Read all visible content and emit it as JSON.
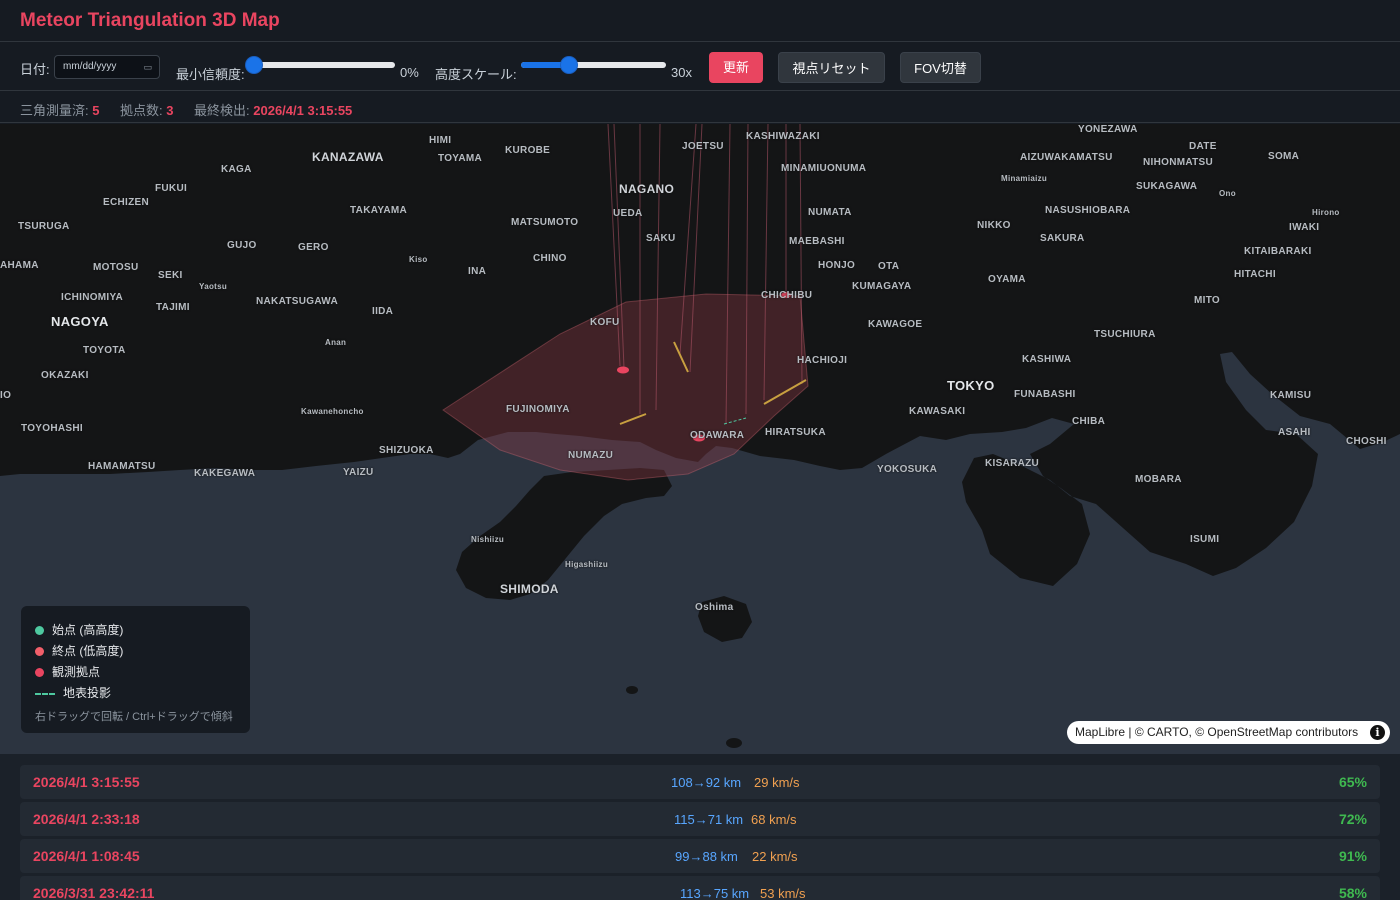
{
  "header": {
    "title": "Meteor Triangulation 3D Map"
  },
  "controls": {
    "date_label": "日付:",
    "date_placeholder": "mm/dd/yyyy",
    "confidence_label": "最小信頼度:",
    "confidence_value": "0%",
    "confidence_level": 0.03,
    "scale_label": "高度スケール:",
    "scale_value": "30x",
    "scale_level": 0.33,
    "refresh_label": "更新",
    "reset_view_label": "視点リセット",
    "fov_toggle_label": "FOV切替"
  },
  "status": {
    "triangulated_label": "三角測量済:",
    "triangulated_count": "5",
    "stations_label": "拠点数:",
    "stations_count": "3",
    "last_detection_label": "最終検出:",
    "last_detection_time": "2026/4/1 3:15:55"
  },
  "map": {
    "places": [
      "KANAZAWA",
      "HIMI",
      "TOYAMA",
      "KUROBE",
      "JOETSU",
      "KASHIWAZAKI",
      "YONEZAWA",
      "DATE",
      "SOMA",
      "AIZUWAKAMATSU",
      "NIHONMATSU",
      "MINAMIUONUMA",
      "Minamiaizu",
      "SUKAGAWA",
      "Ono",
      "KAGA",
      "FUKUI",
      "ECHIZEN",
      "NAGANO",
      "UEDA",
      "NUMATA",
      "NASUSHIOBARA",
      "Hirono",
      "IWAKI",
      "TSURUGA",
      "TAKAYAMA",
      "MATSUMOTO",
      "SAKU",
      "MAEBASHI",
      "NIKKO",
      "SAKURA",
      "KITAIBARAKI",
      "GUJO",
      "GERO",
      "CHINO",
      "HONJO",
      "OTA",
      "HITACHI",
      "AHAMA",
      "MOTOSU",
      "SEKI",
      "Kiso",
      "INA",
      "KUMAGAYA",
      "OYAMA",
      "Yaotsu",
      "CHICHIBU",
      "MITO",
      "ICHINOMIYA",
      "TAJIMI",
      "NAKATSUGAWA",
      "IIDA",
      "KOFU",
      "KAWAGOE",
      "TSUCHIURA",
      "NAGOYA",
      "Anan",
      "HACHIOJI",
      "KASHIWA",
      "TOYOTA",
      "TOKYO",
      "FUNABASHI",
      "KAMISU",
      "OKAZAKI",
      "IO",
      "Kawanehoncho",
      "FUJINOMIYA",
      "KAWASAKI",
      "CHIBA",
      "ODAWARA",
      "HIRATSUKA",
      "ASAHI",
      "TOYOHASHI",
      "SHIZUOKA",
      "CHOSHI",
      "NUMAZU",
      "YOKOSUKA",
      "KISARAZU",
      "HAMAMATSU",
      "KAKEGAWA",
      "YAIZU",
      "MOBARA",
      "Nishiizu",
      "ISUMI",
      "Higashiizu",
      "SHIMODA",
      "Oshima"
    ]
  },
  "legend": {
    "start_label": "始点 (高高度)",
    "end_label": "終点 (低高度)",
    "station_label": "観測拠点",
    "projection_label": "地表投影",
    "hint": "右ドラッグで回転 / Ctrl+ドラッグで傾斜",
    "colors": {
      "start": "#4ec9a0",
      "end": "#f25f6a",
      "station": "#e94560",
      "projection": "#4ec9a0"
    }
  },
  "attribution": {
    "text": "MapLibre | © CARTO, © OpenStreetMap contributors",
    "info_icon": "i"
  },
  "detections": [
    {
      "time": "2026/4/1 3:15:55",
      "altitude": "108→92 km",
      "speed": "29 km/s",
      "confidence": "65%"
    },
    {
      "time": "2026/4/1 2:33:18",
      "altitude": "115→71 km",
      "speed": "68 km/s",
      "confidence": "72%"
    },
    {
      "time": "2026/4/1 1:08:45",
      "altitude": "99→88 km",
      "speed": "22 km/s",
      "confidence": "91%"
    },
    {
      "time": "2026/3/31 23:42:11",
      "altitude": "113→75 km",
      "speed": "53 km/s",
      "confidence": "58%"
    }
  ]
}
